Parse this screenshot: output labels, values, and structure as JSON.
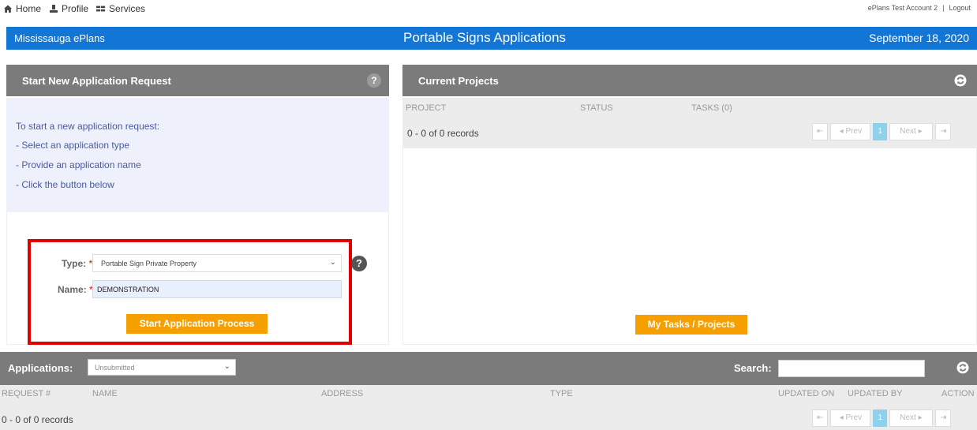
{
  "topnav": {
    "home": "Home",
    "profile": "Profile",
    "services": "Services",
    "account": "ePlans Test Account 2",
    "separator": "|",
    "logout": "Logout"
  },
  "bluebar": {
    "left": "Mississauga ePlans",
    "title": "Portable Signs Applications",
    "date": "September 18, 2020"
  },
  "new_request": {
    "title": "Start New Application Request",
    "help": "?",
    "instructions": [
      "To start a new application request:",
      "- Select an application type",
      "- Provide an application name",
      "- Click the button below"
    ],
    "type_label": "Type:",
    "name_label": "Name:",
    "required": "*",
    "type_value": "Portable Sign Private Property",
    "name_value": "DEMONSTRATION",
    "start_button": "Start Application Process"
  },
  "current_projects": {
    "title": "Current Projects",
    "columns": [
      "PROJECT",
      "STATUS",
      "TASKS (0)"
    ],
    "records": "0 - 0 of 0 records",
    "pager": {
      "first": "⇤",
      "prev": "◂ Prev",
      "page": "1",
      "next": "Next ▸",
      "last": "⇥"
    },
    "tasks_button": "My Tasks / Projects"
  },
  "applications": {
    "title": "Applications:",
    "filter_value": "Unsubmitted",
    "search_label": "Search:",
    "columns": [
      "REQUEST #",
      "NAME",
      "ADDRESS",
      "TYPE",
      "UPDATED ON",
      "UPDATED BY",
      "ACTION"
    ],
    "records": "0 - 0 of 0 records",
    "pager": {
      "first": "⇤",
      "prev": "◂ Prev",
      "page": "1",
      "next": "Next ▸",
      "last": "⇥"
    }
  },
  "colors": {
    "accent_blue": "#1276d6",
    "header_gray": "#7b7b7b",
    "button_orange": "#f5a000",
    "highlight_red": "#e00000"
  }
}
